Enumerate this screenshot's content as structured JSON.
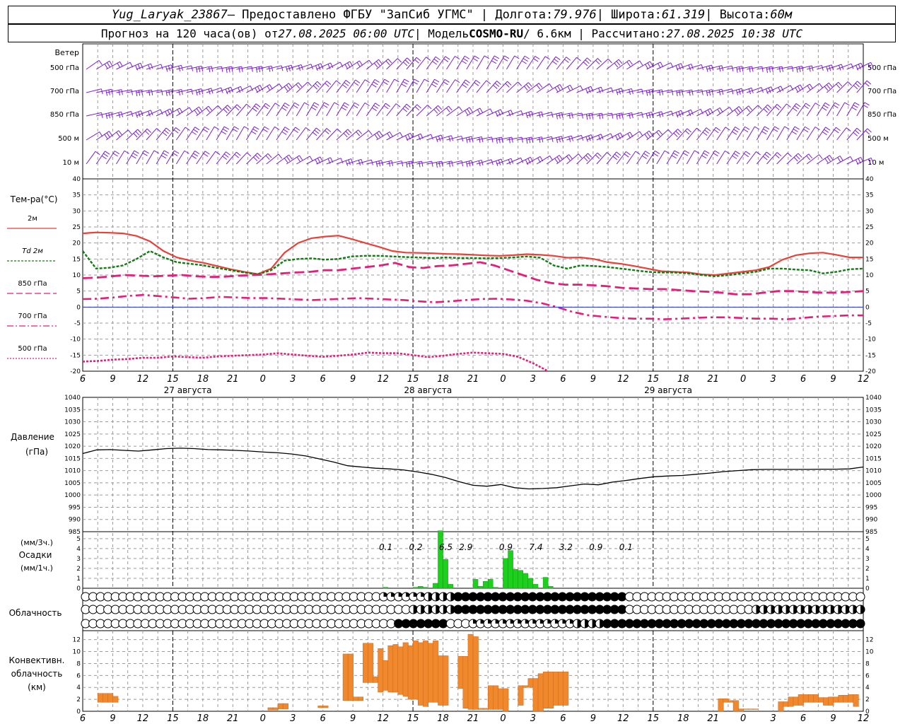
{
  "header": {
    "station": "Yug_Laryak_23867",
    "provider": " — Предоставлено ФГБУ \"ЗапСиб УГМС\" | Долгота: ",
    "lon": "79.976",
    "lat_label": " | Широта: ",
    "lat": "61.319",
    "alt_label": " | Высота: ",
    "alt": "60м",
    "line2_a": "Прогноз на 120 часа(ов) от ",
    "issued": "27.08.2025 06:00 UTC",
    "line2_b": " | Модель ",
    "model": "COSMO-RU",
    "line2_c": " / 6.6км | Рассчитано: ",
    "computed": "27.08.2025 10:38 UTC"
  },
  "wind": {
    "title": "Ветер",
    "levels": [
      "500 гПа",
      "700 гПа",
      "850 гПа",
      "500 м",
      "10 м"
    ]
  },
  "temp": {
    "title": "Тем-ра(°C)",
    "legend": [
      "2м",
      "Td  2м",
      "850 гПа",
      "700 гПа",
      "500 гПа"
    ],
    "yticks": [
      40,
      35,
      30,
      25,
      20,
      15,
      10,
      5,
      0,
      -5,
      -10,
      -15,
      -20
    ]
  },
  "time_ticks": [
    "6",
    "9",
    "12",
    "15",
    "18",
    "21",
    "0",
    "3",
    "6",
    "9",
    "12",
    "15",
    "18",
    "21",
    "0",
    "3",
    "6",
    "9",
    "12",
    "15",
    "18",
    "21",
    "0",
    "3",
    "6",
    "9",
    "12"
  ],
  "dates": [
    "27 августа",
    "28 августа",
    "29 августа"
  ],
  "pressure": {
    "title": "Давление",
    "unit": "(гПа)",
    "yticks": [
      1040,
      1035,
      1030,
      1025,
      1020,
      1015,
      1010,
      1005,
      1000,
      995,
      990,
      985
    ]
  },
  "precip": {
    "label1": "(мм/3ч.)",
    "label2": "Осадки",
    "label3": "(мм/1ч.)",
    "yticks": [
      5,
      4,
      3,
      2,
      1,
      0
    ],
    "sums": [
      "0.1",
      "0.2",
      "6.5",
      "2.9",
      "0.9",
      "7.4",
      "3.2",
      "0.9",
      "0.1"
    ]
  },
  "cloud": {
    "title": "Облачность"
  },
  "convective": {
    "label1": "Конвективн.",
    "label2": "облачность",
    "label3": "(км)",
    "yticks": [
      12,
      10,
      8,
      6,
      4,
      2,
      0
    ]
  },
  "colors": {
    "wind": "#7a1fd0",
    "t2m": "#e8413a",
    "td2m": "#147a14",
    "t850": "#e0207a",
    "t700": "#e0207a",
    "t500": "#e0207a",
    "precip": "#1ed01e",
    "conv": "#f0882e"
  },
  "chart_data": [
    {
      "type": "line",
      "x_hours": [
        0,
        3,
        6,
        9,
        12,
        15,
        18,
        21,
        24,
        27,
        30,
        33,
        36,
        39,
        42,
        45,
        48,
        51,
        54,
        57,
        60,
        63,
        66,
        69,
        72,
        75,
        78,
        81,
        84,
        87,
        90,
        93,
        96,
        99,
        102,
        105,
        108,
        111,
        114,
        117,
        120,
        123,
        126,
        129,
        132,
        135,
        138,
        141,
        144,
        147,
        150,
        153,
        156
      ],
      "series": [
        {
          "name": "2м",
          "values": [
            23,
            23.3,
            23.2,
            23,
            22.2,
            20.5,
            17.5,
            15.5,
            14.5,
            13.8,
            12.8,
            11.8,
            11,
            10.3,
            12,
            17,
            20,
            21.5,
            22,
            22.3,
            21.2,
            20,
            18.8,
            17.5,
            17,
            16.9,
            16.8,
            16.6,
            16.5,
            16.3,
            16.1,
            16,
            16.2,
            16.5,
            16.3,
            16,
            15.4,
            15.5,
            15,
            14,
            13.5,
            12.8,
            12,
            11.2,
            11,
            10.8,
            10.2,
            10,
            10.5,
            11,
            11.5,
            12.5,
            14.8,
            16.2,
            16.8,
            17,
            16.3,
            15.5,
            15.5
          ]
        },
        {
          "name": "Td  2м",
          "values": [
            17.5,
            12,
            12.3,
            13,
            15,
            17.5,
            15.5,
            14,
            13.5,
            13,
            12.2,
            11.5,
            10.8,
            10.2,
            11.5,
            14.5,
            15,
            15.2,
            14.8,
            15,
            15.8,
            16,
            16,
            15.8,
            15.6,
            15.5,
            15.3,
            15.5,
            15.3,
            15.3,
            15.2,
            15.3,
            15.5,
            15.8,
            15.4,
            13,
            12,
            13,
            12.8,
            12.5,
            12,
            11.5,
            11,
            10.8,
            10.8,
            10.5,
            10,
            9.6,
            10,
            10.5,
            11,
            12,
            12,
            11.7,
            11.5,
            10.5,
            11,
            11.8,
            12
          ]
        },
        {
          "name": "850 гПа",
          "values": [
            9,
            9.2,
            9.6,
            10,
            9.8,
            9.6,
            9.8,
            10,
            9.6,
            9.4,
            9.5,
            9.8,
            10,
            10.2,
            10.5,
            10.8,
            11,
            11.5,
            11.5,
            12,
            12.5,
            13,
            13.8,
            12.5,
            12.2,
            12.8,
            13,
            13.5,
            14,
            13,
            11.5,
            10,
            8.5,
            7.5,
            7,
            7,
            6.8,
            6.5,
            6,
            5.8,
            5.6,
            5.6,
            5.3,
            5,
            4.8,
            4.5,
            4,
            4,
            4.5,
            5,
            5,
            4.7,
            4.5,
            4.5,
            4.7,
            5
          ]
        },
        {
          "name": "700 гПа",
          "values": [
            2.5,
            2.6,
            3,
            3.5,
            3.8,
            3.4,
            3,
            2.6,
            2.8,
            3.2,
            3,
            2.8,
            2.8,
            2.6,
            2.4,
            2.2,
            2.4,
            2.6,
            2.8,
            2.6,
            2.4,
            2.2,
            1.8,
            1.5,
            1.8,
            2.2,
            2.5,
            2.6,
            2.4,
            2,
            1.2,
            0,
            -1.5,
            -2.5,
            -3,
            -3.4,
            -3.6,
            -3.6,
            -3.8,
            -3.6,
            -3.4,
            -3.2,
            -3.2,
            -3.4,
            -3.6,
            -3.6,
            -3.8,
            -3.4,
            -3,
            -2.8,
            -2.6,
            -2.6
          ]
        },
        {
          "name": "500 гПа",
          "values": [
            -17,
            -16.8,
            -16.4,
            -16.2,
            -15.8,
            -15.8,
            -15.4,
            -15.6,
            -15.8,
            -15.4,
            -15.2,
            -15,
            -14.8,
            -14.4,
            -14.8,
            -15.2,
            -15.5,
            -15.2,
            -14.8,
            -14.2,
            -14.4,
            -14.4,
            -15,
            -15.6,
            -15.2,
            -14.6,
            -14.2,
            -14.4,
            -14.6,
            -15.5,
            -17.5,
            -20
          ]
        }
      ],
      "xlabel": "",
      "ylabel": "Тем-ра(°C)",
      "ylim": [
        -20,
        40
      ]
    },
    {
      "type": "line",
      "x_hours": [
        0,
        6,
        12,
        18,
        24,
        30,
        36,
        42,
        48,
        54,
        60,
        66,
        72,
        78,
        84,
        90,
        96,
        102,
        108,
        114,
        120,
        126,
        132,
        138,
        144,
        150,
        156
      ],
      "series": [
        {
          "name": "Давление",
          "values": [
            1017,
            1018.5,
            1018.6,
            1018.3,
            1018,
            1018.5,
            1019,
            1019.2,
            1019,
            1018.6,
            1018.5,
            1018.3,
            1018,
            1017.6,
            1017.3,
            1016.8,
            1016,
            1014.8,
            1013.5,
            1012,
            1011.5,
            1011,
            1010.7,
            1010.3,
            1009.5,
            1008.5,
            1007.2,
            1005.5,
            1004,
            1003.6,
            1004.3,
            1003,
            1002.5,
            1002.7,
            1003,
            1003.8,
            1004.5,
            1004.2,
            1005.3,
            1006,
            1006.8,
            1007.5,
            1007.8,
            1008,
            1008.5,
            1009,
            1009.6,
            1010,
            1010.4,
            1010.5,
            1010.5,
            1010.5,
            1010.5,
            1010.6,
            1010.6,
            1010.7,
            1011.5
          ]
        }
      ],
      "ylim": [
        985,
        1040
      ]
    },
    {
      "type": "bar",
      "x_hours_start": [
        60,
        61,
        62,
        63,
        64,
        65,
        66,
        67,
        68,
        69,
        70,
        71,
        72,
        73,
        74,
        75,
        76,
        77,
        78,
        79,
        80,
        81,
        82,
        83,
        84,
        85,
        86,
        87,
        88,
        89,
        90,
        91,
        92,
        93
      ],
      "values": [
        0.1,
        0,
        0,
        0,
        0,
        0,
        0.1,
        0.2,
        0.1,
        0,
        0.5,
        5.8,
        2.9,
        0.4,
        0,
        0,
        0,
        0,
        0.9,
        0.2,
        0.7,
        0.9,
        0.1,
        0,
        3,
        3.8,
        1.9,
        1.8,
        1.5,
        1,
        0.4,
        0,
        1.1,
        0.2
      ],
      "ylim": [
        0,
        5.5
      ]
    },
    {
      "type": "bar",
      "x_hours_start": [
        3,
        4,
        5,
        6,
        7,
        8,
        9,
        10,
        11,
        12,
        13,
        14,
        15,
        16,
        17,
        18,
        19,
        20,
        21,
        22,
        23,
        24,
        25,
        26,
        27,
        28,
        29,
        30,
        31,
        32,
        33,
        34,
        35,
        36,
        37,
        38,
        39,
        40,
        41,
        42,
        43,
        44,
        45,
        46,
        47,
        48,
        49,
        50,
        51,
        52,
        53,
        54,
        55,
        56,
        57,
        58,
        59,
        60,
        61,
        62,
        63,
        64,
        65,
        66,
        67,
        68,
        69,
        70,
        71,
        72,
        73,
        74,
        75,
        76,
        77,
        78,
        79,
        80,
        81,
        82,
        83,
        84,
        85,
        86,
        87,
        88,
        89,
        90,
        91,
        92,
        93,
        94,
        95,
        96,
        97,
        98,
        99,
        100,
        101,
        102,
        103,
        104,
        105,
        106,
        107,
        108,
        109,
        110,
        111,
        112,
        113,
        114,
        115,
        116,
        117,
        118,
        119,
        120,
        121,
        122,
        123,
        124,
        125,
        126,
        127,
        128,
        129,
        130,
        131,
        132,
        133,
        134,
        135,
        136,
        137,
        138,
        139,
        140,
        141,
        142,
        143,
        144,
        145,
        146,
        147,
        148,
        149,
        150,
        151,
        152,
        153,
        154,
        155,
        156
      ],
      "bottom": [
        1.5,
        1.5,
        1.5,
        1.5,
        0,
        0,
        0,
        0,
        0,
        0,
        0,
        0,
        0,
        0,
        0,
        0,
        0,
        0,
        0,
        0,
        0,
        0,
        0,
        0,
        0,
        0,
        0,
        0,
        0,
        0,
        0,
        0,
        0,
        0,
        0.2,
        0.2,
        0.4,
        0.4,
        0,
        0,
        0,
        0,
        0,
        0,
        0.6,
        0.6,
        0,
        0,
        0,
        1.8,
        1.8,
        1.8,
        1.8,
        4.8,
        4.8,
        4.8,
        3.2,
        3.5,
        3.2,
        3.2,
        2.8,
        2.5,
        2.0,
        2.0,
        1.0,
        0.8,
        1.5,
        1.5,
        1.0,
        1.0,
        0,
        0,
        3.8,
        0.5,
        0.3,
        0.3,
        0.3,
        0.3,
        0.3,
        0.3,
        0.3,
        0,
        0,
        1.0,
        1.0,
        4.0,
        4.0,
        0,
        0,
        0.5,
        0.5,
        1.0,
        1.0,
        1.0,
        1.0,
        0,
        0,
        0,
        0,
        0,
        0,
        0,
        0,
        0,
        0,
        0,
        0,
        0,
        0,
        0,
        0,
        0,
        0,
        0,
        0,
        0,
        0,
        0,
        0,
        0,
        0,
        0,
        0,
        0,
        0,
        1.5,
        1.5,
        0,
        0,
        0.3,
        0.3,
        0.3,
        0.3,
        0,
        0,
        0,
        0,
        0.8,
        0.8,
        1.0,
        1.0,
        1.5,
        1.5,
        1.5,
        1.5,
        1.0,
        1.0,
        1.5,
        1.5,
        1.5,
        1.5,
        0.8,
        0.8
      ],
      "values": [
        3,
        3,
        3,
        2.5,
        0,
        0,
        0,
        0,
        0,
        0,
        0,
        0,
        0,
        0,
        0,
        0,
        0,
        0,
        0,
        0,
        0,
        0,
        0,
        0,
        0,
        0,
        0,
        0,
        0,
        0,
        0,
        0,
        0,
        0,
        0.6,
        0.6,
        1.3,
        1.3,
        0,
        0,
        0,
        0,
        0,
        0,
        0.9,
        0.9,
        0,
        0,
        0,
        9.6,
        9.6,
        2.4,
        2.4,
        11.4,
        11.4,
        5.8,
        10.5,
        8.5,
        11,
        11.2,
        10.8,
        11.5,
        11,
        11.8,
        11.5,
        11.8,
        11.4,
        11.8,
        9.3,
        9.3,
        0,
        0,
        9.2,
        9.2,
        12.9,
        12.5,
        0.5,
        0.5,
        4.3,
        4.3,
        3.8,
        3.8,
        0,
        0,
        4.3,
        4.3,
        5.5,
        5.5,
        6.3,
        6.6,
        6.6,
        6.6,
        6.6,
        6.6,
        0,
        0,
        0,
        0,
        0,
        0,
        0,
        0,
        0,
        0,
        0,
        0,
        0,
        0,
        0,
        0,
        0,
        0,
        0,
        0,
        0,
        0,
        0,
        0,
        0,
        0,
        0,
        0,
        0,
        0,
        2.1,
        2.1,
        1.8,
        1.8,
        0.4,
        0.4,
        0.4,
        0.4,
        0,
        0,
        0,
        0,
        1.6,
        1.6,
        2.4,
        2.4,
        2.8,
        2.8,
        2.8,
        2.8,
        2.3,
        2.3,
        2.4,
        2.4,
        2.7,
        2.7,
        2.8,
        2.8
      ],
      "ylim": [
        0,
        13
      ]
    }
  ]
}
